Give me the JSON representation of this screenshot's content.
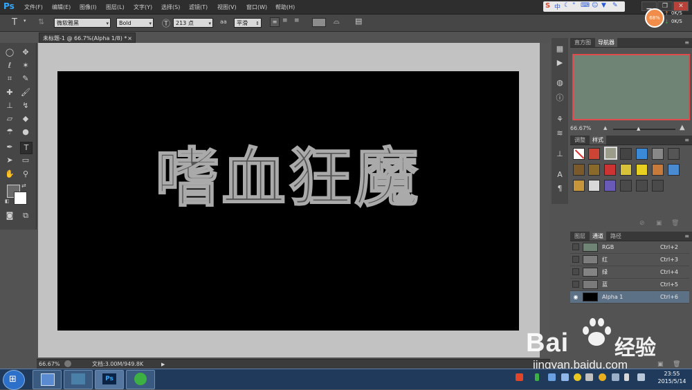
{
  "app": {
    "logo": "Ps"
  },
  "menu": [
    "文件(F)",
    "编辑(E)",
    "图像(I)",
    "图层(L)",
    "文字(Y)",
    "选择(S)",
    "滤镜(T)",
    "视图(V)",
    "窗口(W)",
    "帮助(H)"
  ],
  "options": {
    "font_family": "微软雅黑",
    "font_style": "Bold",
    "font_size": "213 点",
    "antialias": "平滑",
    "aa_label": "aa"
  },
  "document": {
    "tab_title": "未标题-1 @ 66.7%(Alpha 1/8) *",
    "canvas_text": "嗜血狂魔"
  },
  "status": {
    "zoom": "66.67%",
    "doc_info": "文档:3.00M/949.8K"
  },
  "speed": {
    "percent": "68%",
    "up": "0K/S",
    "down": "0K/S"
  },
  "navigator": {
    "tabs": [
      "直方图",
      "导航器"
    ],
    "zoom": "66.67%"
  },
  "styles": {
    "tabs": [
      "调整",
      "样式"
    ]
  },
  "channels": {
    "tabs": [
      "图层",
      "通道",
      "路径"
    ],
    "rows": [
      {
        "name": "RGB",
        "shortcut": "Ctrl+2",
        "thumb": "#6f8474"
      },
      {
        "name": "红",
        "shortcut": "Ctrl+3",
        "thumb": "#7d7d7d"
      },
      {
        "name": "绿",
        "shortcut": "Ctrl+4",
        "thumb": "#848484"
      },
      {
        "name": "蓝",
        "shortcut": "Ctrl+5",
        "thumb": "#7a7a7a"
      },
      {
        "name": "Alpha 1",
        "shortcut": "Ctrl+6",
        "thumb": "#000000"
      }
    ]
  },
  "clock": {
    "time": "23:55",
    "date": "2015/5/14"
  },
  "watermark": {
    "brand": "Bai",
    "brand2": "经验",
    "url": "jingyan.baidu.com"
  },
  "colors": {
    "accent": "#31a8ff",
    "selection": "#5d7186",
    "nav_frame": "#e04a4a"
  }
}
